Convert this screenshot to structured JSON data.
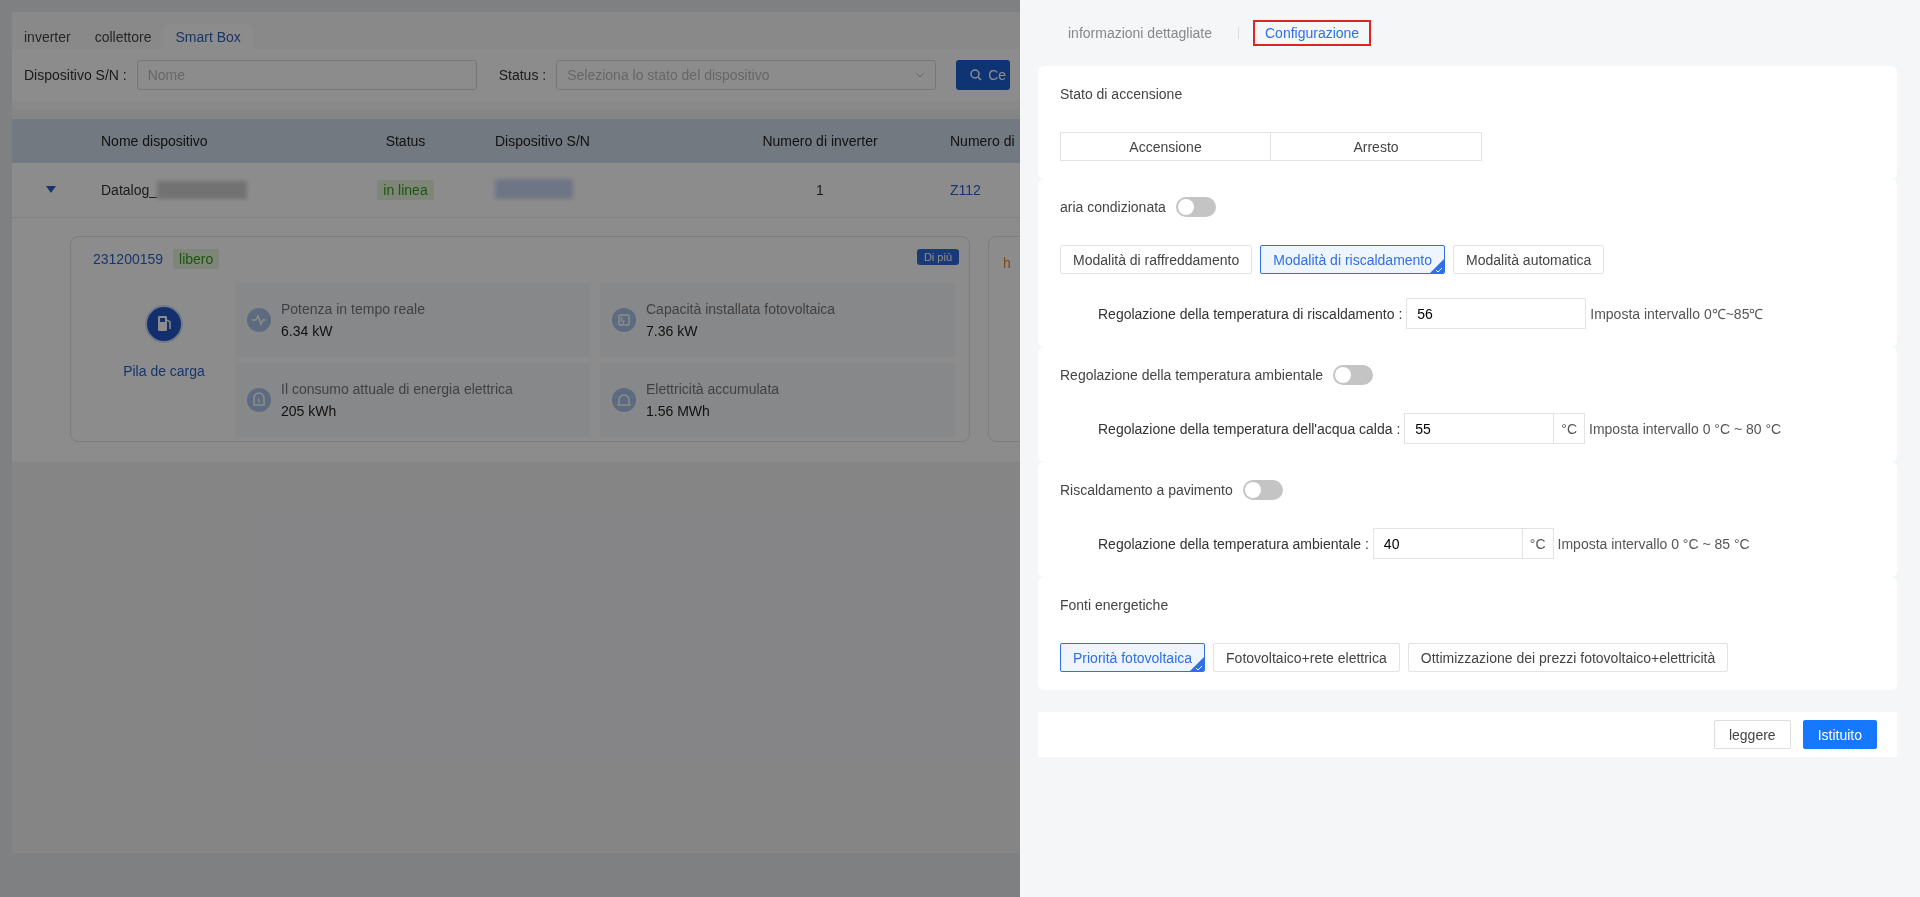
{
  "tabs": [
    {
      "label": "inverter",
      "selected": false
    },
    {
      "label": "collettore",
      "selected": false
    },
    {
      "label": "Smart Box",
      "selected": true
    }
  ],
  "filters": [
    {
      "kind": "text",
      "label": "Dispositivo S/N :",
      "placeholder": "Nome"
    },
    {
      "kind": "select",
      "label": "Status :",
      "placeholder": "Seleziona lo stato del dispositivo"
    }
  ],
  "search_button": "Ce",
  "table": {
    "columns": [
      "Nome dispositivo",
      "Status",
      "Dispositivo S/N",
      "Numero di inverter",
      "Numero di"
    ],
    "rows": [
      {
        "expanded": true,
        "name": "Datalog_",
        "status": "in linea",
        "inverters": "1",
        "column_5": "Z112"
      }
    ]
  },
  "detail_card": {
    "id": "231200159",
    "state": "libero",
    "more": "Di più",
    "device": "Pila de carga",
    "metrics": [
      {
        "label": "Potenza in tempo reale",
        "value": "6.34 kW"
      },
      {
        "label": "Capacità installata fotovoltaica",
        "value": "7.36 kW"
      },
      {
        "label": "Il consumo attuale di energia elettrica",
        "value": "205 kWh"
      },
      {
        "label": "Elettricità accumulata",
        "value": "1.56 MWh"
      }
    ]
  },
  "partial_card": {
    "text": "h"
  },
  "drawer": {
    "tabs": [
      {
        "label": "informazioni dettagliate",
        "selected": false,
        "highlighted": false
      },
      {
        "label": "Configurazione",
        "selected": true,
        "highlighted": true
      }
    ],
    "sections": [
      {
        "title": "Stato di accensione",
        "kind": "segmented",
        "options": [
          {
            "label": "Accensione",
            "selected": false
          },
          {
            "label": "Arresto",
            "selected": false
          }
        ]
      },
      {
        "title": "aria condizionata",
        "on": false,
        "kind": "chips",
        "options": [
          {
            "label": "Modalità di raffreddamento",
            "selected": false
          },
          {
            "label": "Modalità di riscaldamento",
            "selected": true
          },
          {
            "label": "Modalità automatica",
            "selected": false
          }
        ],
        "field": {
          "label": "Regolazione della temperatura di riscaldamento :",
          "value": "56",
          "hint": "Imposta intervallo 0℃~85℃"
        }
      },
      {
        "title": "Regolazione della temperatura ambientale",
        "on": false,
        "field": {
          "label": "Regolazione della temperatura dell'acqua calda :",
          "value": "55",
          "unit": "°C",
          "hint": "Imposta intervallo 0 °C ~ 80 °C"
        }
      },
      {
        "title": "Riscaldamento a pavimento",
        "on": false,
        "field": {
          "label": "Regolazione della temperatura ambientale :",
          "value": "40",
          "unit": "°C",
          "hint": "Imposta intervallo 0 °C ~ 85 °C"
        }
      },
      {
        "title": "Fonti energetiche",
        "kind": "chips",
        "options": [
          {
            "label": "Priorità fotovoltaica",
            "selected": true
          },
          {
            "label": "Fotovoltaico+rete elettrica",
            "selected": false
          },
          {
            "label": "Ottimizzazione dei prezzi fotovoltaico+elettricità",
            "selected": false
          }
        ]
      }
    ],
    "buttons": [
      {
        "label": "leggere",
        "primary": false
      },
      {
        "label": "Istituito",
        "primary": true
      }
    ]
  }
}
